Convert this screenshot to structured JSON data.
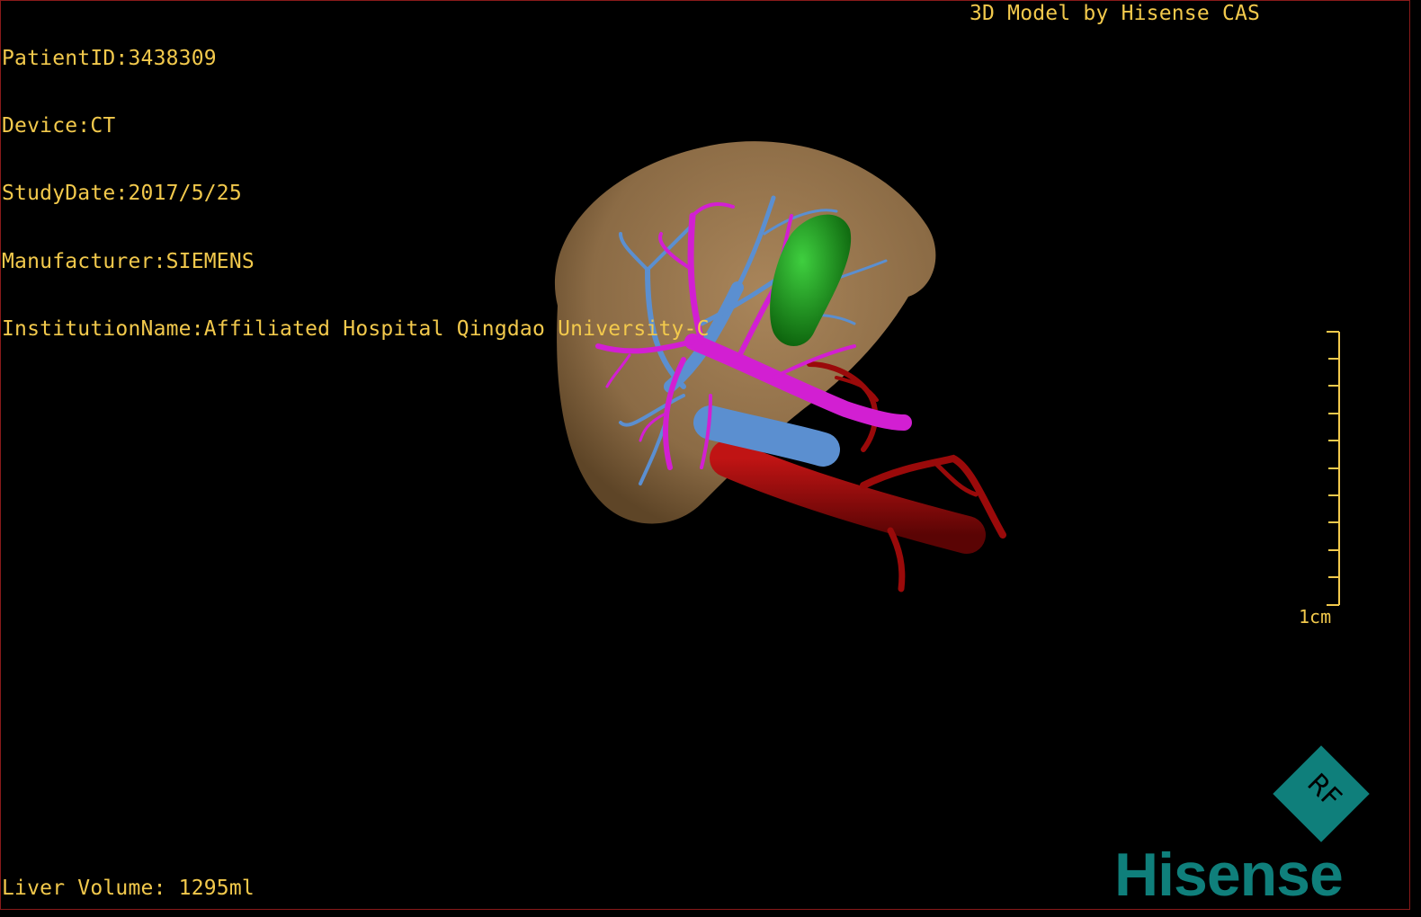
{
  "meta": {
    "patient_id": "PatientID:3438309",
    "device": "Device:CT",
    "study_date": "StudyDate:2017/5/25",
    "manufacturer": "Manufacturer:SIEMENS",
    "institution": "InstitutionName:Affiliated Hospital Qingdao University-C"
  },
  "model_credit": "3D Model by Hisense CAS",
  "liver_volume": "Liver Volume: 1295ml",
  "scale": {
    "label": "1cm"
  },
  "logo": {
    "text": "Hisense",
    "badge": "RF"
  },
  "colors": {
    "overlay_text": "#f2c94c",
    "liver": "#8b6b45",
    "gallbladder": "#1e8a1e",
    "portal_vein": "#d21fd2",
    "hepatic_vein": "#5b8fd0",
    "artery": "#9a0a0a",
    "logo_teal": "#0f7f7b"
  }
}
